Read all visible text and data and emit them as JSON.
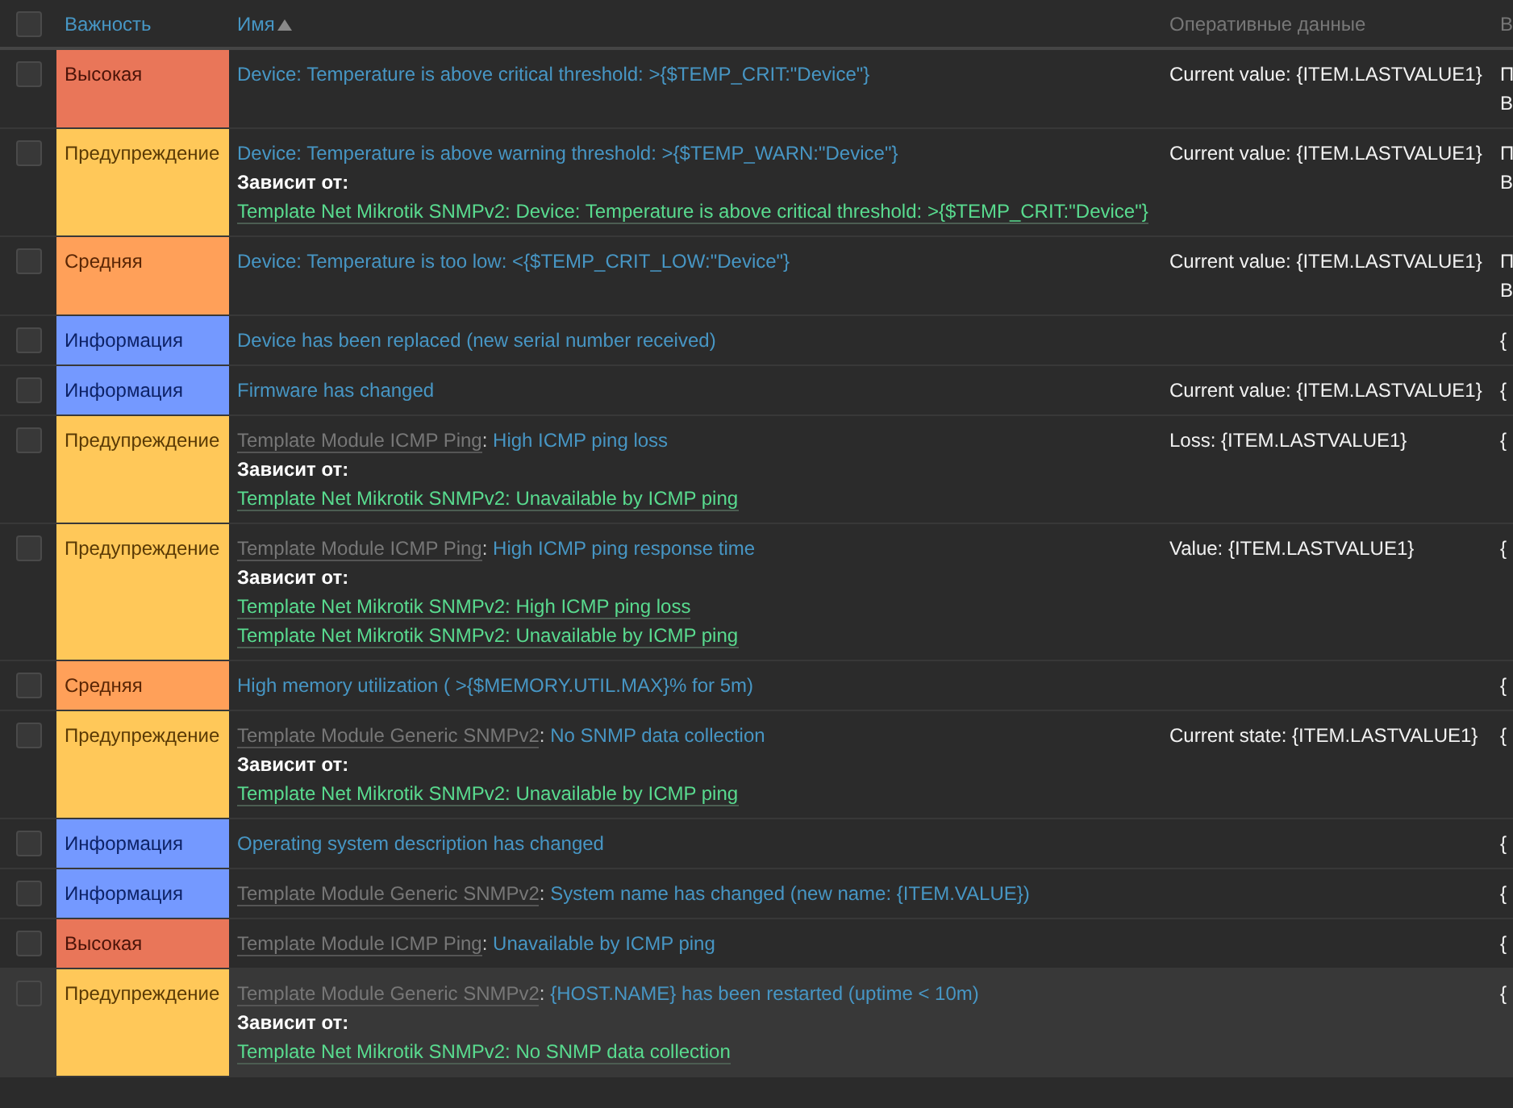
{
  "header": {
    "select_all_checked": false,
    "severity": "Важность",
    "name": "Имя",
    "operational_data": "Оперативные данные",
    "column_5": "В"
  },
  "rows": [
    {
      "checked": false,
      "highlighted": false,
      "severity": {
        "kind": "high",
        "label": "Высокая"
      },
      "name": "Device: Temperature is above critical threshold: >{$TEMP_CRIT:\"Device\"}",
      "operational_data": "Current value: {ITEM.LASTVALUE1}",
      "column_5": [
        "П",
        "В"
      ]
    },
    {
      "checked": false,
      "highlighted": false,
      "severity": {
        "kind": "warning",
        "label": "Предупреждение"
      },
      "name": "Device: Temperature is above warning threshold: >{$TEMP_WARN:\"Device\"}",
      "depends_label": "Зависит от:",
      "depends": [
        "Template Net Mikrotik SNMPv2: Device: Temperature is above critical threshold: >{$TEMP_CRIT:\"Device\"}"
      ],
      "operational_data": "Current value: {ITEM.LASTVALUE1}",
      "column_5": [
        "П",
        "В"
      ]
    },
    {
      "checked": false,
      "highlighted": false,
      "severity": {
        "kind": "average",
        "label": "Средняя"
      },
      "name": "Device: Temperature is too low: <{$TEMP_CRIT_LOW:\"Device\"}",
      "operational_data": "Current value: {ITEM.LASTVALUE1}",
      "column_5": [
        "П",
        "В"
      ]
    },
    {
      "checked": false,
      "highlighted": false,
      "severity": {
        "kind": "info",
        "label": "Информация"
      },
      "name": "Device has been replaced (new serial number received)",
      "column_5": [
        "{"
      ]
    },
    {
      "checked": false,
      "highlighted": false,
      "severity": {
        "kind": "info",
        "label": "Информация"
      },
      "name": "Firmware has changed",
      "operational_data": "Current value: {ITEM.LASTVALUE1}",
      "column_5": [
        "{"
      ]
    },
    {
      "checked": false,
      "highlighted": false,
      "severity": {
        "kind": "warning",
        "label": "Предупреждение"
      },
      "template": "Template Module ICMP Ping",
      "separator": ":",
      "name": "High ICMP ping loss",
      "depends_label": "Зависит от:",
      "depends": [
        "Template Net Mikrotik SNMPv2: Unavailable by ICMP ping"
      ],
      "operational_data": "Loss: {ITEM.LASTVALUE1}",
      "column_5": [
        "{"
      ]
    },
    {
      "checked": false,
      "highlighted": false,
      "severity": {
        "kind": "warning",
        "label": "Предупреждение"
      },
      "template": "Template Module ICMP Ping",
      "separator": ":",
      "name": "High ICMP ping response time",
      "depends_label": "Зависит от:",
      "depends": [
        "Template Net Mikrotik SNMPv2: High ICMP ping loss",
        "Template Net Mikrotik SNMPv2: Unavailable by ICMP ping"
      ],
      "operational_data": "Value: {ITEM.LASTVALUE1}",
      "column_5": [
        "{"
      ]
    },
    {
      "checked": false,
      "highlighted": false,
      "severity": {
        "kind": "average",
        "label": "Средняя"
      },
      "name": "High memory utilization ( >{$MEMORY.UTIL.MAX}% for 5m)",
      "column_5": [
        "{"
      ]
    },
    {
      "checked": false,
      "highlighted": false,
      "severity": {
        "kind": "warning",
        "label": "Предупреждение"
      },
      "template": "Template Module Generic SNMPv2",
      "separator": ":",
      "name": "No SNMP data collection",
      "depends_label": "Зависит от:",
      "depends": [
        "Template Net Mikrotik SNMPv2: Unavailable by ICMP ping"
      ],
      "operational_data": "Current state: {ITEM.LASTVALUE1}",
      "column_5": [
        "{"
      ]
    },
    {
      "checked": false,
      "highlighted": false,
      "severity": {
        "kind": "info",
        "label": "Информация"
      },
      "name": "Operating system description has changed",
      "column_5": [
        "{"
      ]
    },
    {
      "checked": false,
      "highlighted": false,
      "severity": {
        "kind": "info",
        "label": "Информация"
      },
      "template": "Template Module Generic SNMPv2",
      "separator": ":",
      "name": "System name has changed (new name: {ITEM.VALUE})",
      "column_5": [
        "{"
      ]
    },
    {
      "checked": false,
      "highlighted": false,
      "severity": {
        "kind": "high",
        "label": "Высокая"
      },
      "template": "Template Module ICMP Ping",
      "separator": ":",
      "name": "Unavailable by ICMP ping",
      "column_5": [
        "{"
      ]
    },
    {
      "checked": false,
      "highlighted": true,
      "severity": {
        "kind": "warning",
        "label": "Предупреждение"
      },
      "template": "Template Module Generic SNMPv2",
      "separator": ":",
      "name": "{HOST.NAME} has been restarted (uptime < 10m)",
      "depends_label": "Зависит от:",
      "depends": [
        "Template Net Mikrotik SNMPv2: No SNMP data collection"
      ],
      "column_5": [
        "{"
      ]
    }
  ]
}
